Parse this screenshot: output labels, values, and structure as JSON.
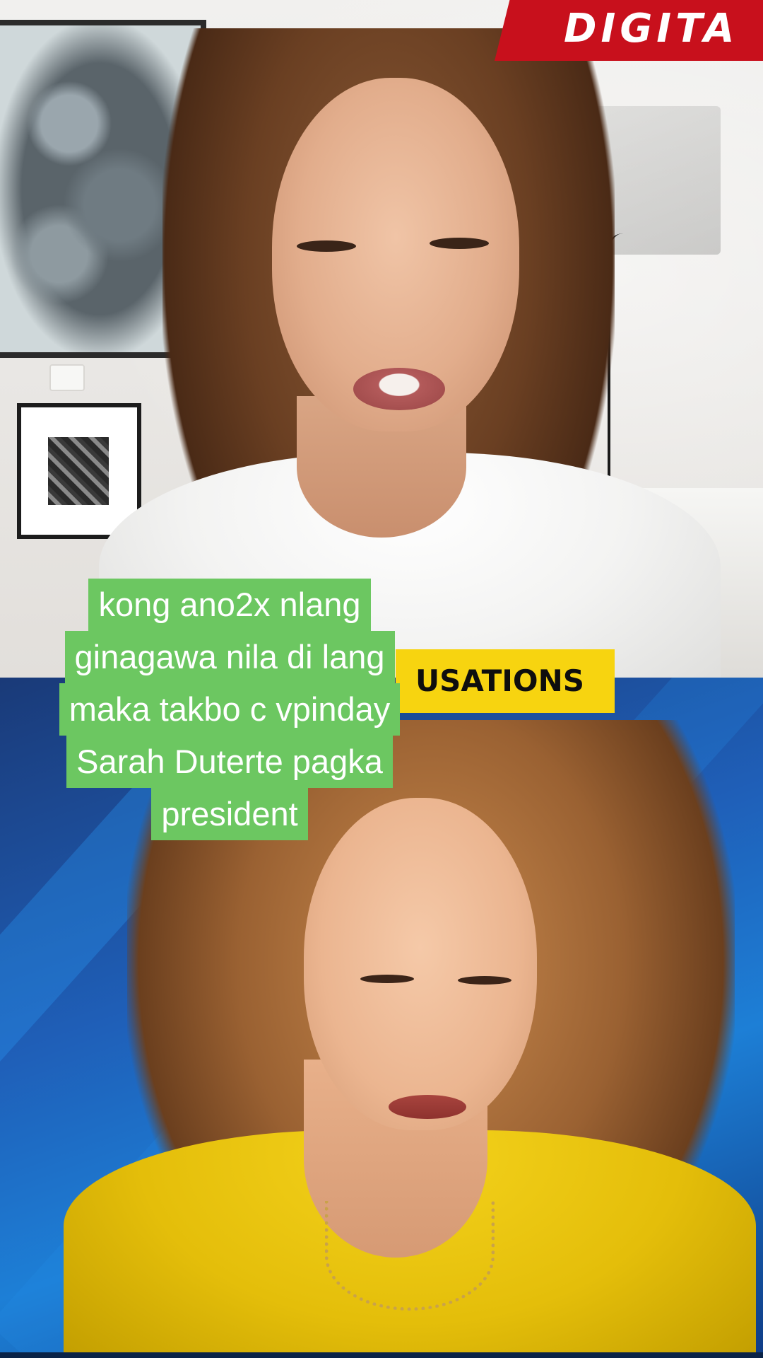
{
  "banner": {
    "channel_text": "DIGITA",
    "color": "#c8101c"
  },
  "lower_third": {
    "text": "USATIONS",
    "color": "#f7d410"
  },
  "caption": {
    "color": "#6cc761",
    "lines": [
      "kong ano2x nlang",
      "ginagawa nila di lang",
      "maka takbo c vpinday",
      "Sarah Duterte pagka",
      "president"
    ]
  },
  "panels": {
    "top_background": "#ecebe8",
    "bottom_background": "#1f5fb8"
  }
}
